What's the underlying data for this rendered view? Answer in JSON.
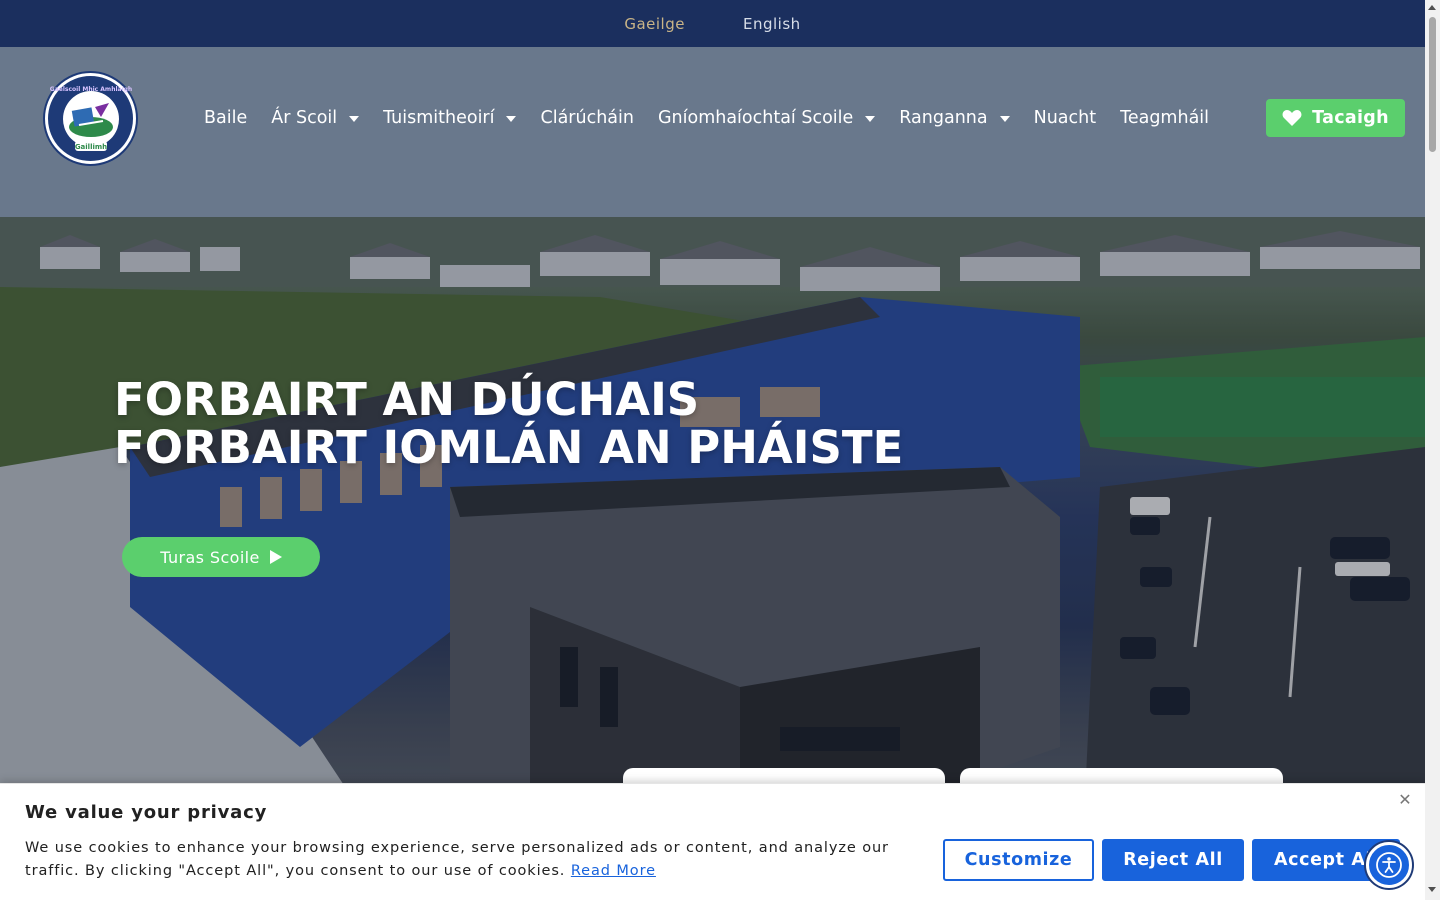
{
  "language_bar": {
    "gaeilge": "Gaeilge",
    "english": "English"
  },
  "header": {
    "logo": {
      "icon": "school-crest-logo",
      "arc_text": "Gaelscoil Mhic Amhlaigh",
      "bottom_text": "Gaillimh"
    },
    "nav": [
      {
        "label": "Baile",
        "has_dropdown": false
      },
      {
        "label": "Ár Scoil",
        "has_dropdown": true
      },
      {
        "label": "Tuismitheoirí",
        "has_dropdown": true
      },
      {
        "label": "Clárúcháin",
        "has_dropdown": false
      },
      {
        "label": "Gníomhaíochtaí Scoile",
        "has_dropdown": true
      },
      {
        "label": "Ranganna",
        "has_dropdown": true
      },
      {
        "label": "Nuacht",
        "has_dropdown": false
      },
      {
        "label": "Teagmháil",
        "has_dropdown": false
      }
    ],
    "donate_label": "Tacaigh",
    "donate_icon": "heart-icon"
  },
  "hero": {
    "headline_line1": "FORBAIRT AN DÚCHAIS",
    "headline_line2": "FORBAIRT IOMLÁN AN PHÁISTE",
    "tour_label": "Turas Scoile",
    "tour_icon": "play-icon"
  },
  "cookie_banner": {
    "title": "We value your privacy",
    "text": "We use cookies to enhance your browsing experience, serve personalized ads or content, and analyze our traffic. By clicking \"Accept All\", you consent to our use of cookies.",
    "read_more": "Read More",
    "customize": "Customize",
    "reject_all": "Reject All",
    "accept_all": "Accept All",
    "close_icon": "close-icon"
  },
  "accessibility": {
    "icon": "accessibility-icon"
  },
  "colors": {
    "top_bar": "#1b2f5e",
    "accent_green": "#5bcf6d",
    "cookie_blue": "#1863dc",
    "lang_active": "#c9b487"
  }
}
